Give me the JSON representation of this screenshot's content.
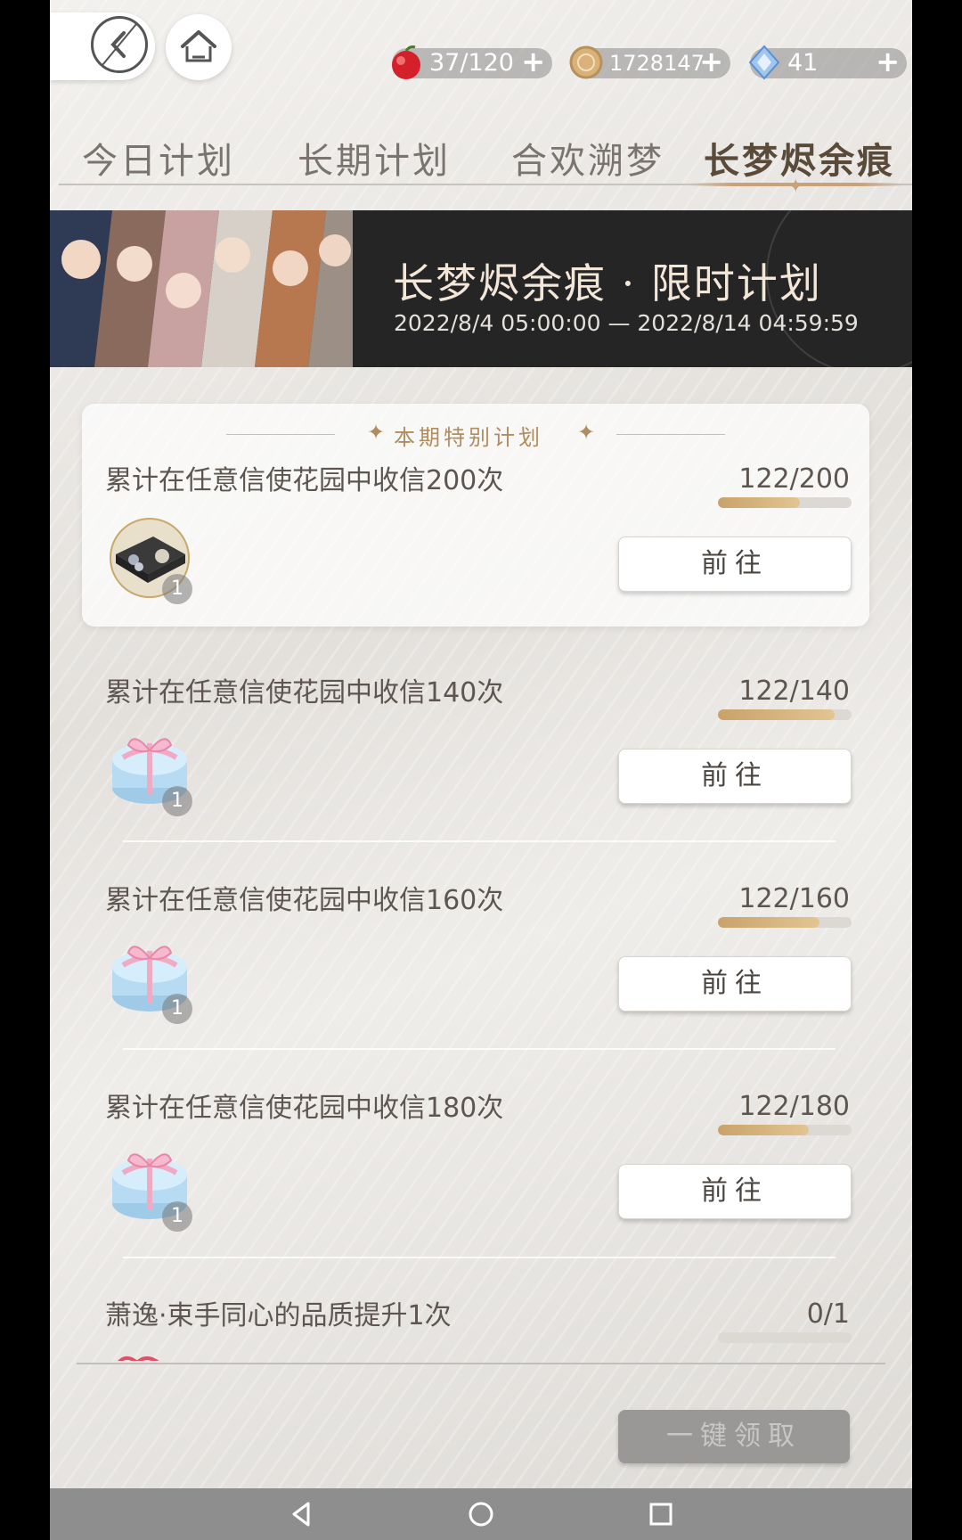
{
  "resources": {
    "stamina": "37/120",
    "coins": "1728147",
    "gems": "41",
    "plus": "+"
  },
  "tabs": [
    "今日计划",
    "长期计划",
    "合欢溯梦",
    "长梦烬余痕"
  ],
  "active_tab": 3,
  "banner": {
    "title": "长梦烬余痕 · 限时计划",
    "dates": "2022/8/4 05:00:00 — 2022/8/14 04:59:59"
  },
  "special_header": "本期特别计划",
  "tasks": [
    {
      "desc": "累计在任意信使花园中收信200次",
      "progress": "122/200",
      "fraction": 0.61,
      "qty": "1",
      "button": "前往"
    },
    {
      "desc": "累计在任意信使花园中收信140次",
      "progress": "122/140",
      "fraction": 0.871,
      "qty": "1",
      "button": "前往"
    },
    {
      "desc": "累计在任意信使花园中收信160次",
      "progress": "122/160",
      "fraction": 0.7625,
      "qty": "1",
      "button": "前往"
    },
    {
      "desc": "累计在任意信使花园中收信180次",
      "progress": "122/180",
      "fraction": 0.678,
      "qty": "1",
      "button": "前往"
    },
    {
      "desc": "萧逸·束手同心的品质提升1次",
      "progress": "0/1",
      "fraction": 0
    }
  ],
  "claim_all": "一键领取",
  "colors": {
    "accent": "#c9a27a",
    "banner_bg": "#262525"
  }
}
